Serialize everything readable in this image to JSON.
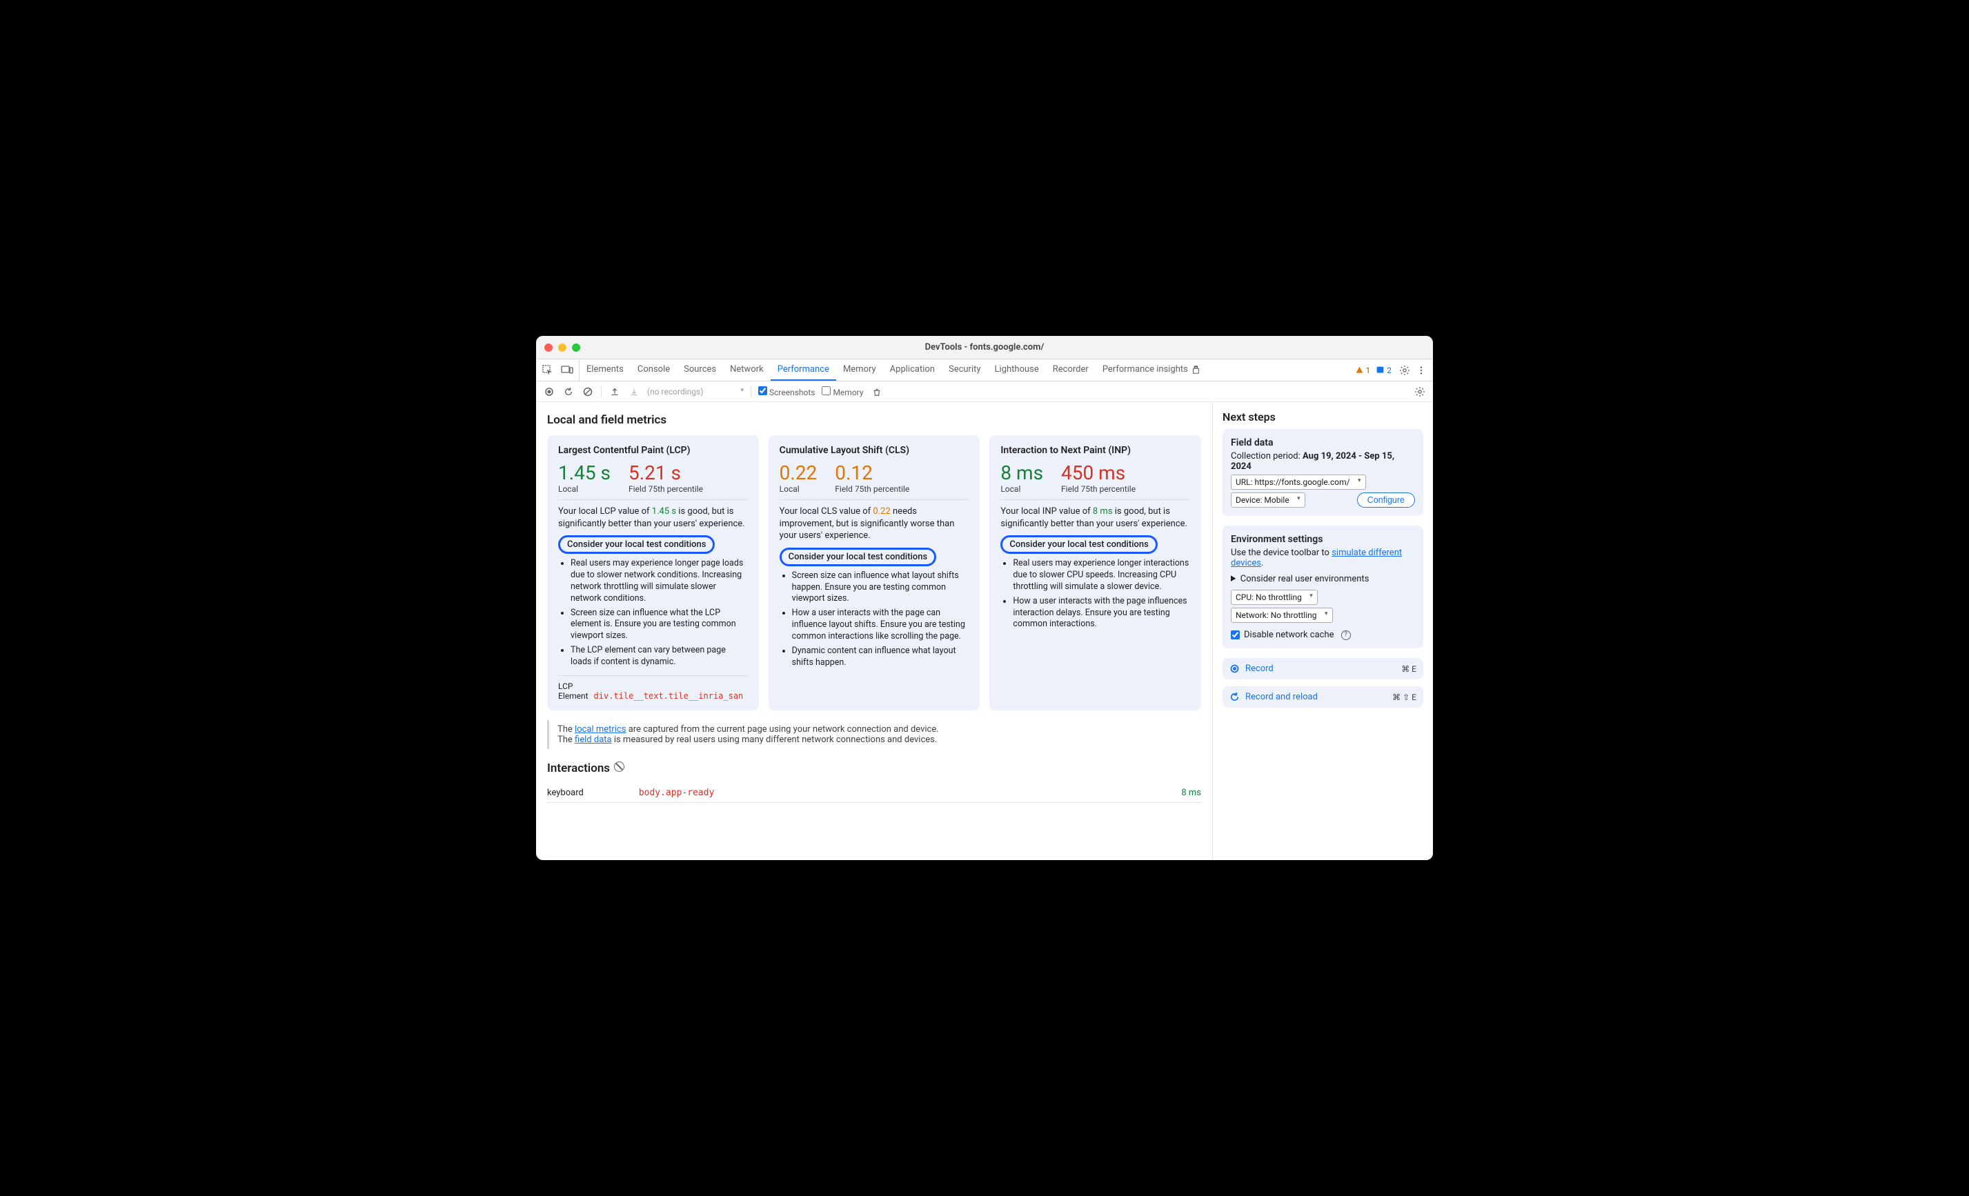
{
  "window_title": "DevTools - fonts.google.com/",
  "tabs": {
    "elements": "Elements",
    "console": "Console",
    "sources": "Sources",
    "network": "Network",
    "performance": "Performance",
    "memory": "Memory",
    "application": "Application",
    "security": "Security",
    "lighthouse": "Lighthouse",
    "recorder": "Recorder",
    "performance_insights": "Performance insights"
  },
  "badges": {
    "warn_count": "1",
    "info_count": "2"
  },
  "toolbar": {
    "recordings_placeholder": "(no recordings)",
    "screenshots": "Screenshots",
    "memory": "Memory"
  },
  "section_title": "Local and field metrics",
  "lcp": {
    "title": "Largest Contentful Paint (LCP)",
    "local_val": "1.45 s",
    "local_label": "Local",
    "field_val": "5.21 s",
    "field_label": "Field 75th percentile",
    "desc_pre": "Your local LCP value of ",
    "desc_highlight": "1.45 s",
    "desc_post": " is good, but is significantly better than your users' experience.",
    "summary": "Consider your local test conditions",
    "bullets": [
      "Real users may experience longer page loads due to slower network conditions. Increasing network throttling will simulate slower network conditions.",
      "Screen size can influence what the LCP element is. Ensure you are testing common viewport sizes.",
      "The LCP element can vary between page loads if content is dynamic."
    ],
    "el_label": "LCP Element",
    "el_code": "div.tile__text.tile__inria_san"
  },
  "cls": {
    "title": "Cumulative Layout Shift (CLS)",
    "local_val": "0.22",
    "local_label": "Local",
    "field_val": "0.12",
    "field_label": "Field 75th percentile",
    "desc_pre": "Your local CLS value of ",
    "desc_highlight": "0.22",
    "desc_post": " needs improvement, but is significantly worse than your users' experience.",
    "summary": "Consider your local test conditions",
    "bullets": [
      "Screen size can influence what layout shifts happen. Ensure you are testing common viewport sizes.",
      "How a user interacts with the page can influence layout shifts. Ensure you are testing common interactions like scrolling the page.",
      "Dynamic content can influence what layout shifts happen."
    ]
  },
  "inp": {
    "title": "Interaction to Next Paint (INP)",
    "local_val": "8 ms",
    "local_label": "Local",
    "field_val": "450 ms",
    "field_label": "Field 75th percentile",
    "desc_pre": "Your local INP value of ",
    "desc_highlight": "8 ms",
    "desc_post": " is good, but is significantly better than your users' experience.",
    "summary": "Consider your local test conditions",
    "bullets": [
      "Real users may experience longer interactions due to slower CPU speeds. Increasing CPU throttling will simulate a slower device.",
      "How a user interacts with the page influences interaction delays. Ensure you are testing common interactions."
    ]
  },
  "note": {
    "t1": "The ",
    "a1": "local metrics",
    "t2": " are captured from the current page using your network connection and device.",
    "t3": "The ",
    "a2": "field data",
    "t4": " is measured by real users using many different network connections and devices."
  },
  "interactions": {
    "title": "Interactions",
    "type": "keyboard",
    "selector": "body.app-ready",
    "time": "8 ms"
  },
  "side": {
    "next_steps": "Next steps",
    "field_data": {
      "title": "Field data",
      "period_label": "Collection period: ",
      "period_value": "Aug 19, 2024 - Sep 15, 2024",
      "url": "URL: https://fonts.google.com/",
      "device": "Device: Mobile",
      "configure": "Configure"
    },
    "env": {
      "title": "Environment settings",
      "desc": "Use the device toolbar to ",
      "link": "simulate different devices",
      "consider": "Consider real user environments",
      "cpu": "CPU: No throttling",
      "network": "Network: No throttling",
      "disable_cache": "Disable network cache"
    },
    "record": {
      "label": "Record",
      "shortcut": "⌘ E"
    },
    "record_reload": {
      "label": "Record and reload",
      "shortcut": "⌘ ⇧ E"
    }
  }
}
